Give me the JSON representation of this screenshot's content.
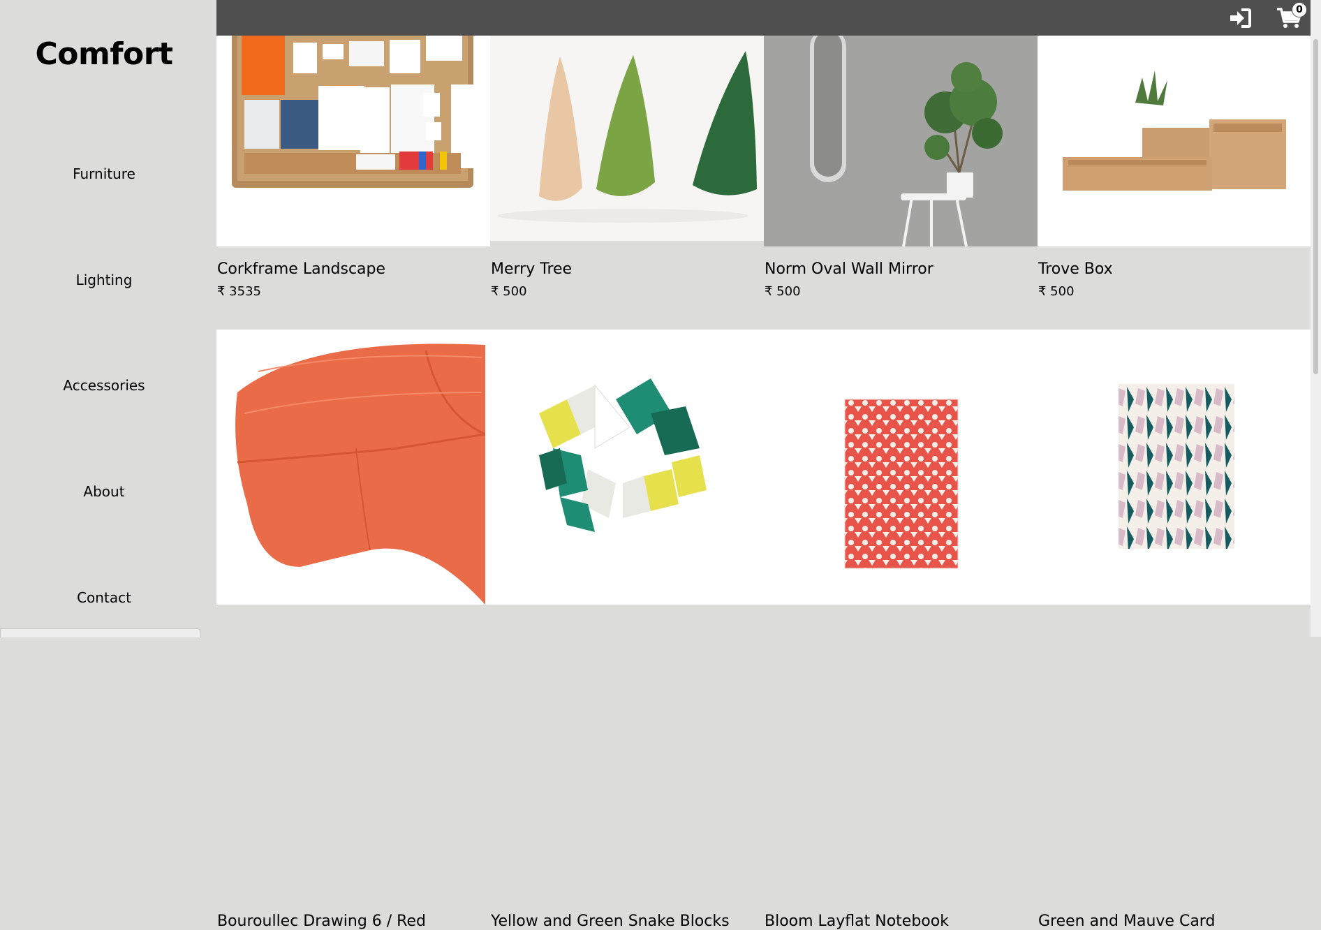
{
  "brand": {
    "name": "Comfort"
  },
  "nav": [
    {
      "label": "Furniture"
    },
    {
      "label": "Lighting"
    },
    {
      "label": "Accessories"
    },
    {
      "label": "About"
    },
    {
      "label": "Contact"
    }
  ],
  "header": {
    "login_icon": "sign-in-icon",
    "cart_icon": "shopping-cart-icon",
    "cart_count": "0",
    "bar_color": "#4f4f4f"
  },
  "products": [
    {
      "name": "Corkframe Landscape",
      "price": "₹ 3535"
    },
    {
      "name": "Merry Tree",
      "price": "₹ 500"
    },
    {
      "name": "Norm Oval Wall Mirror",
      "price": "₹ 500"
    },
    {
      "name": "Trove Box",
      "price": "₹ 500"
    },
    {
      "name": "Bouroullec Drawing 6 / Red"
    },
    {
      "name": "Yellow and Green Snake Blocks"
    },
    {
      "name": "Bloom Layflat Notebook"
    },
    {
      "name": "Green and Mauve Card"
    }
  ]
}
